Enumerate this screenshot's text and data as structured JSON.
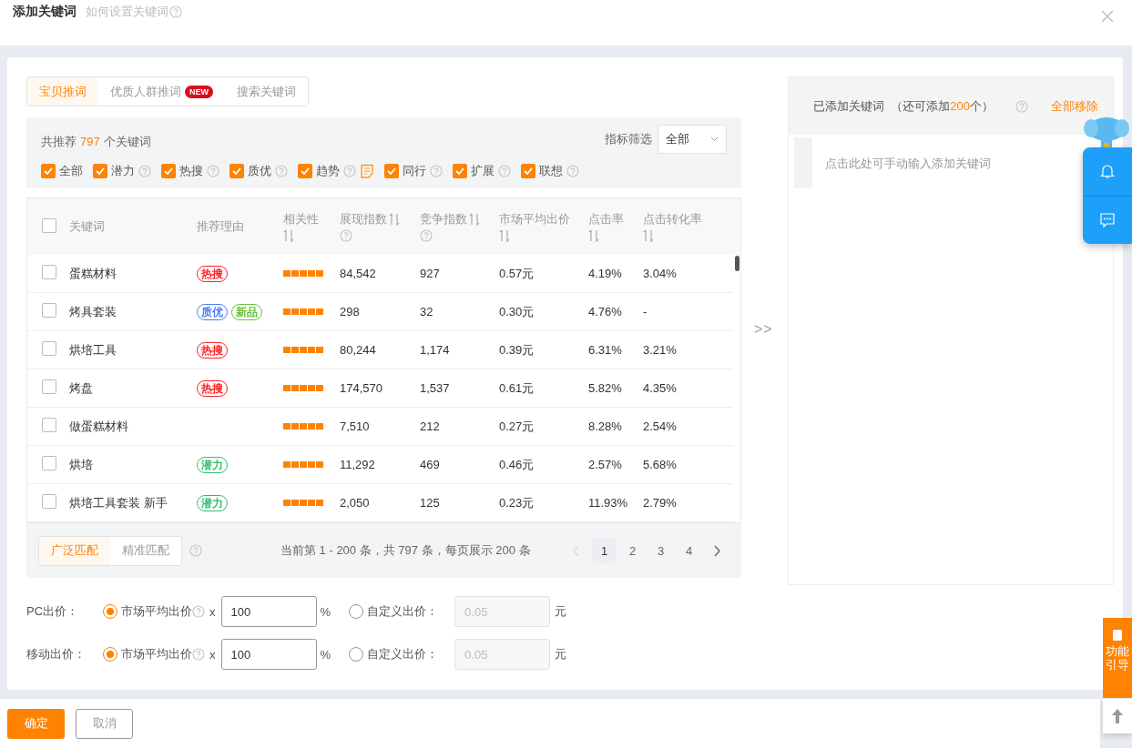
{
  "dialog": {
    "title": "添加关键词",
    "help_link": "如何设置关键词"
  },
  "tabs": [
    {
      "label": "宝贝推词",
      "selected": true
    },
    {
      "label": "优质人群推词",
      "selected": false,
      "badge": "NEW"
    },
    {
      "label": "搜索关键词",
      "selected": false
    }
  ],
  "summary": {
    "prefix": "共推荐",
    "count": "797",
    "suffix": "个关键词"
  },
  "indicator_filter": {
    "label": "指标筛选",
    "value": "全部"
  },
  "filters": [
    {
      "label": "全部",
      "checked": true,
      "help": false,
      "note": false
    },
    {
      "label": "潜力",
      "checked": true,
      "help": true,
      "note": false
    },
    {
      "label": "热搜",
      "checked": true,
      "help": true,
      "note": false
    },
    {
      "label": "质优",
      "checked": true,
      "help": true,
      "note": false
    },
    {
      "label": "趋势",
      "checked": true,
      "help": true,
      "note": true
    },
    {
      "label": "同行",
      "checked": true,
      "help": true,
      "note": false
    },
    {
      "label": "扩展",
      "checked": true,
      "help": true,
      "note": false
    },
    {
      "label": "联想",
      "checked": true,
      "help": true,
      "note": false
    }
  ],
  "table": {
    "select_all_checked": false,
    "columns": [
      {
        "label": "关键词",
        "sortable": false,
        "help": false
      },
      {
        "label": "推荐理由",
        "sortable": false,
        "help": false
      },
      {
        "label": "相关性",
        "sortable": true,
        "help": false
      },
      {
        "label": "展现指数",
        "sortable": true,
        "help": true
      },
      {
        "label": "竞争指数",
        "sortable": true,
        "help": true
      },
      {
        "label": "市场平均出价",
        "sortable": true,
        "help": false
      },
      {
        "label": "点击率",
        "sortable": true,
        "help": false
      },
      {
        "label": "点击转化率",
        "sortable": true,
        "help": false
      }
    ],
    "rows": [
      {
        "checked": false,
        "keyword": "蛋糕材料",
        "tags": [
          {
            "label": "热搜",
            "color": "#ff1f1f"
          }
        ],
        "stars": 5,
        "impressions": "84,542",
        "competition": "927",
        "avg_bid": "0.57元",
        "ctr": "4.19%",
        "cvr": "3.04%"
      },
      {
        "checked": false,
        "keyword": "烤具套装",
        "tags": [
          {
            "label": "质优",
            "color": "#4a7ff5"
          },
          {
            "label": "新品",
            "color": "#66c23a"
          }
        ],
        "stars": 5,
        "impressions": "298",
        "competition": "32",
        "avg_bid": "0.30元",
        "ctr": "4.76%",
        "cvr": "-"
      },
      {
        "checked": false,
        "keyword": "烘培工具",
        "tags": [
          {
            "label": "热搜",
            "color": "#ff1f1f"
          }
        ],
        "stars": 5,
        "impressions": "80,244",
        "competition": "1,174",
        "avg_bid": "0.39元",
        "ctr": "6.31%",
        "cvr": "3.21%"
      },
      {
        "checked": false,
        "keyword": "烤盘",
        "tags": [
          {
            "label": "热搜",
            "color": "#ff1f1f"
          }
        ],
        "stars": 5,
        "impressions": "174,570",
        "competition": "1,537",
        "avg_bid": "0.61元",
        "ctr": "5.82%",
        "cvr": "4.35%"
      },
      {
        "checked": false,
        "keyword": "做蛋糕材料",
        "tags": [],
        "stars": 5,
        "impressions": "7,510",
        "competition": "212",
        "avg_bid": "0.27元",
        "ctr": "8.28%",
        "cvr": "2.54%"
      },
      {
        "checked": false,
        "keyword": "烘培",
        "tags": [
          {
            "label": "潜力",
            "color": "#2dbf6c"
          }
        ],
        "stars": 5,
        "impressions": "11,292",
        "competition": "469",
        "avg_bid": "0.46元",
        "ctr": "2.57%",
        "cvr": "5.68%"
      },
      {
        "checked": false,
        "keyword": "烘培工具套装 新手",
        "tags": [
          {
            "label": "潜力",
            "color": "#2dbf6c"
          }
        ],
        "stars": 5,
        "impressions": "2,050",
        "competition": "125",
        "avg_bid": "0.23元",
        "ctr": "11.93%",
        "cvr": "2.79%"
      }
    ]
  },
  "match_types": [
    {
      "label": "广泛匹配",
      "selected": true
    },
    {
      "label": "精准匹配",
      "selected": false
    }
  ],
  "page_info": "当前第 1 - 200 条，共 797 条，每页展示 200 条",
  "pagination": {
    "prev_disabled": true,
    "pages": [
      {
        "label": "1",
        "selected": true
      },
      {
        "label": "2",
        "selected": false
      },
      {
        "label": "3",
        "selected": false
      },
      {
        "label": "4",
        "selected": false
      }
    ]
  },
  "transfer_label": ">>",
  "bids": [
    {
      "label": "PC出价：",
      "market_label": "市场平均出价",
      "market_selected": true,
      "times": "x",
      "percent": "100",
      "unit_percent": "%",
      "custom_label": "自定义出价：",
      "custom_selected": false,
      "custom_value": "0.05",
      "unit": "元"
    },
    {
      "label": "移动出价：",
      "market_label": "市场平均出价",
      "market_selected": true,
      "times": "x",
      "percent": "100",
      "unit_percent": "%",
      "custom_label": "自定义出价：",
      "custom_selected": false,
      "custom_value": "0.05",
      "unit": "元"
    }
  ],
  "added": {
    "title": "已添加关键词",
    "remain_prefix": "（还可添加",
    "remain_count": "200",
    "remain_suffix": "个）",
    "remove_all": "全部移除",
    "input_placeholder": "点击此处可手动输入添加关键词"
  },
  "side_tab": {
    "line1": "功能",
    "line2": "引导"
  },
  "buttons": [
    {
      "label": "确定",
      "kind": "primary"
    },
    {
      "label": "取消",
      "kind": "secondary"
    }
  ]
}
